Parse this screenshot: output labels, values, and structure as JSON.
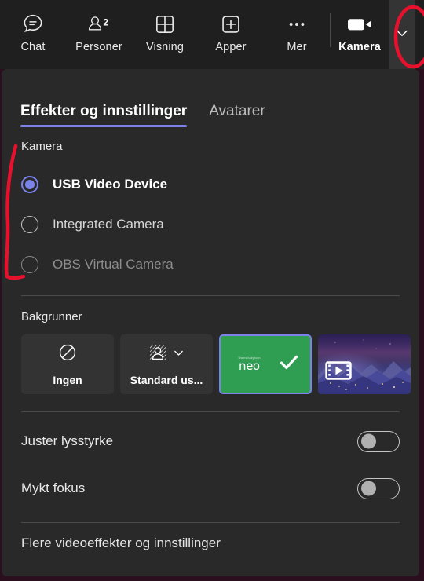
{
  "toolbar": {
    "items": [
      {
        "label": "Chat",
        "icon": "chat-icon",
        "count": ""
      },
      {
        "label": "Personer",
        "icon": "people-icon",
        "count": "2"
      },
      {
        "label": "Visning",
        "icon": "grid-icon",
        "count": ""
      },
      {
        "label": "Apper",
        "icon": "plus-box-icon",
        "count": ""
      },
      {
        "label": "Mer",
        "icon": "ellipsis-icon",
        "count": ""
      }
    ],
    "camera": {
      "label": "Kamera",
      "icon": "camera-on-icon"
    },
    "chevron": {
      "icon": "chevron-down-icon"
    }
  },
  "panel": {
    "tabs": [
      {
        "label": "Effekter og innstillinger",
        "active": true
      },
      {
        "label": "Avatarer",
        "active": false
      }
    ],
    "camera_section": {
      "title": "Kamera",
      "options": [
        {
          "label": "USB Video Device",
          "state": "selected"
        },
        {
          "label": "Integrated Camera",
          "state": "normal"
        },
        {
          "label": "OBS Virtual Camera",
          "state": "disabled"
        }
      ]
    },
    "backgrounds": {
      "title": "Bakgrunner",
      "tiles": [
        {
          "label": "Ingen",
          "icon": "no-background-icon",
          "type": "none",
          "selected": false
        },
        {
          "label": "Standard us...",
          "icon": "blur-person-icon",
          "type": "blur",
          "selected": false,
          "chevron": "chevron-down-icon"
        },
        {
          "label": "neo",
          "icon": "check-icon",
          "type": "image",
          "selected": true,
          "logo_caption": "Teams bakgrunn"
        },
        {
          "label": "",
          "icon": "film-play-icon",
          "type": "video",
          "selected": false
        }
      ]
    },
    "toggles": [
      {
        "label": "Juster lysstyrke",
        "on": false
      },
      {
        "label": "Mykt fokus",
        "on": false
      }
    ],
    "footer_link": "Flere videoeffekter og innstillinger"
  },
  "colors": {
    "accent": "#7b83eb",
    "panel_bg": "#292929",
    "toolbar_bg": "#1f1f1f",
    "annotation": "#e8112d",
    "tile_green": "#2f9e52"
  }
}
